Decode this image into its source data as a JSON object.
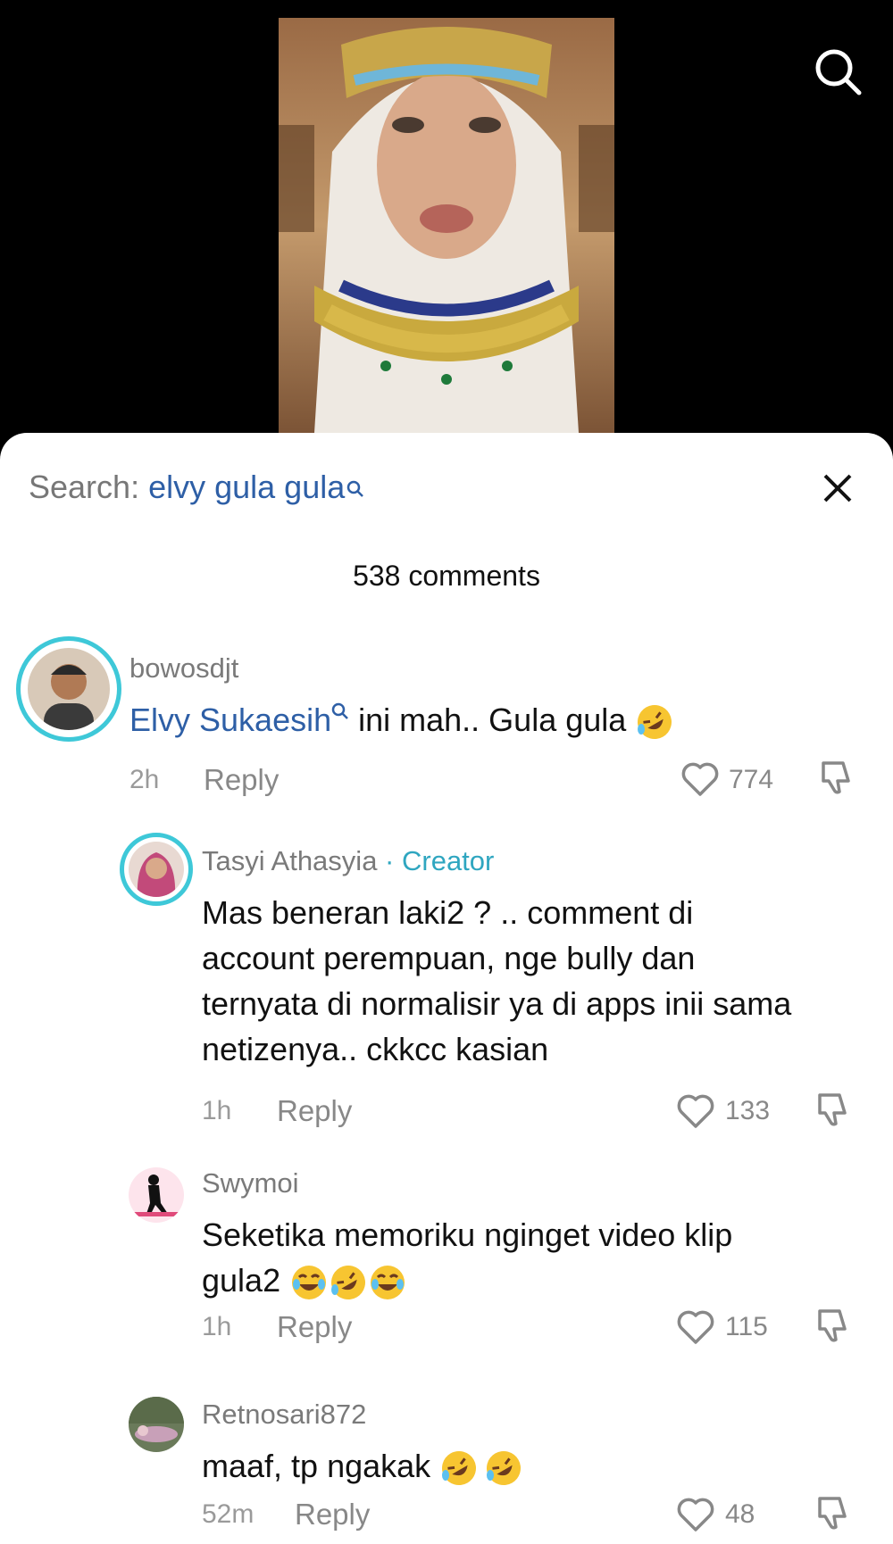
{
  "search": {
    "prefix": "Search:",
    "query": "elvy gula gula"
  },
  "comments_count": "538 comments",
  "comments": [
    {
      "user": "bowosdjt",
      "mention": "Elvy Sukaesih",
      "text": " ini mah.. Gula gula ",
      "emojis": [
        "rofl"
      ],
      "time": "2h",
      "reply": "Reply",
      "likes": "774"
    },
    {
      "user": "Tasyi Athasyia",
      "badge": " · Creator",
      "lines": [
        "Mas beneran laki2 ? .. comment di",
        "account perempuan, nge bully dan",
        "ternyata di normalisir ya di apps inii sama",
        "netizenya.. ckkcc kasian"
      ],
      "time": "1h",
      "reply": "Reply",
      "likes": "133"
    },
    {
      "user": "Swymoi",
      "lines": [
        "Seketika memoriku nginget video klip",
        "gula2"
      ],
      "emojis": [
        "joy",
        "rofl",
        "joy"
      ],
      "time": "1h",
      "reply": "Reply",
      "likes": "115"
    },
    {
      "user": "Retnosari872",
      "text": "maaf, tp ngakak ",
      "emojis": [
        "rofl",
        "rofl"
      ],
      "time": "52m",
      "reply": "Reply",
      "likes": "48"
    }
  ]
}
